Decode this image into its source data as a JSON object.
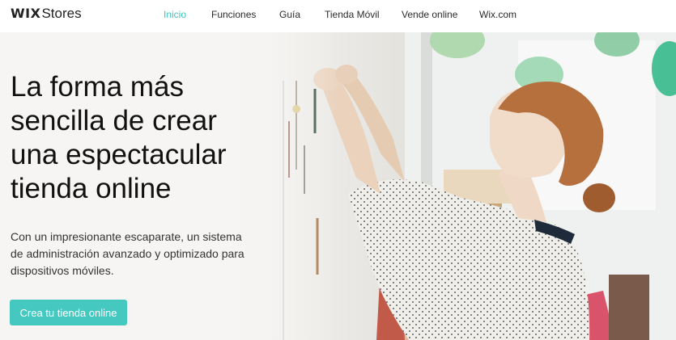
{
  "header": {
    "logo_wix": "WIX",
    "logo_stores": "Stores",
    "nav": [
      {
        "label": "Inicio",
        "active": true
      },
      {
        "label": "Funciones",
        "active": false
      },
      {
        "label": "Guía",
        "active": false
      },
      {
        "label": "Tienda Móvil",
        "active": false
      },
      {
        "label": "Vende online",
        "active": false
      },
      {
        "label": "Wix.com",
        "active": false
      }
    ]
  },
  "hero": {
    "headline": "La forma más sencilla de crear una espectacular tienda online",
    "subtext": "Con un impresionante escaparate, un sistema de administración avanzado y optimizado para dispositivos móviles.",
    "cta_label": "Crea tu tienda online"
  },
  "colors": {
    "accent": "#45c8bf",
    "nav_active": "#3dc4bf",
    "text": "#111111"
  }
}
